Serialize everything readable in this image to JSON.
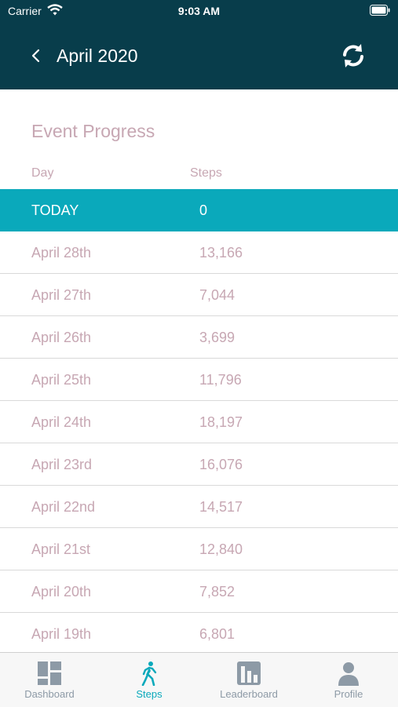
{
  "status_bar": {
    "carrier": "Carrier",
    "time": "9:03 AM"
  },
  "nav": {
    "title": "April 2020"
  },
  "section": {
    "title": "Event Progress"
  },
  "table": {
    "headers": {
      "day": "Day",
      "steps": "Steps"
    },
    "rows": [
      {
        "day": "TODAY",
        "steps": "0"
      },
      {
        "day": "April 28th",
        "steps": "13,166"
      },
      {
        "day": "April 27th",
        "steps": "7,044"
      },
      {
        "day": "April 26th",
        "steps": "3,699"
      },
      {
        "day": "April 25th",
        "steps": "11,796"
      },
      {
        "day": "April 24th",
        "steps": "18,197"
      },
      {
        "day": "April 23rd",
        "steps": "16,076"
      },
      {
        "day": "April 22nd",
        "steps": "14,517"
      },
      {
        "day": "April 21st",
        "steps": "12,840"
      },
      {
        "day": "April 20th",
        "steps": "7,852"
      },
      {
        "day": "April 19th",
        "steps": "6,801"
      }
    ]
  },
  "tabs": [
    {
      "label": "Dashboard",
      "icon": "dashboard-icon"
    },
    {
      "label": "Steps",
      "icon": "walking-icon"
    },
    {
      "label": "Leaderboard",
      "icon": "leaderboard-icon"
    },
    {
      "label": "Profile",
      "icon": "profile-icon"
    }
  ],
  "colors": {
    "header_bg": "#083d4b",
    "accent": "#0aa9bb",
    "muted_text": "#c7a7b3",
    "tab_inactive": "#8d9aa6"
  }
}
